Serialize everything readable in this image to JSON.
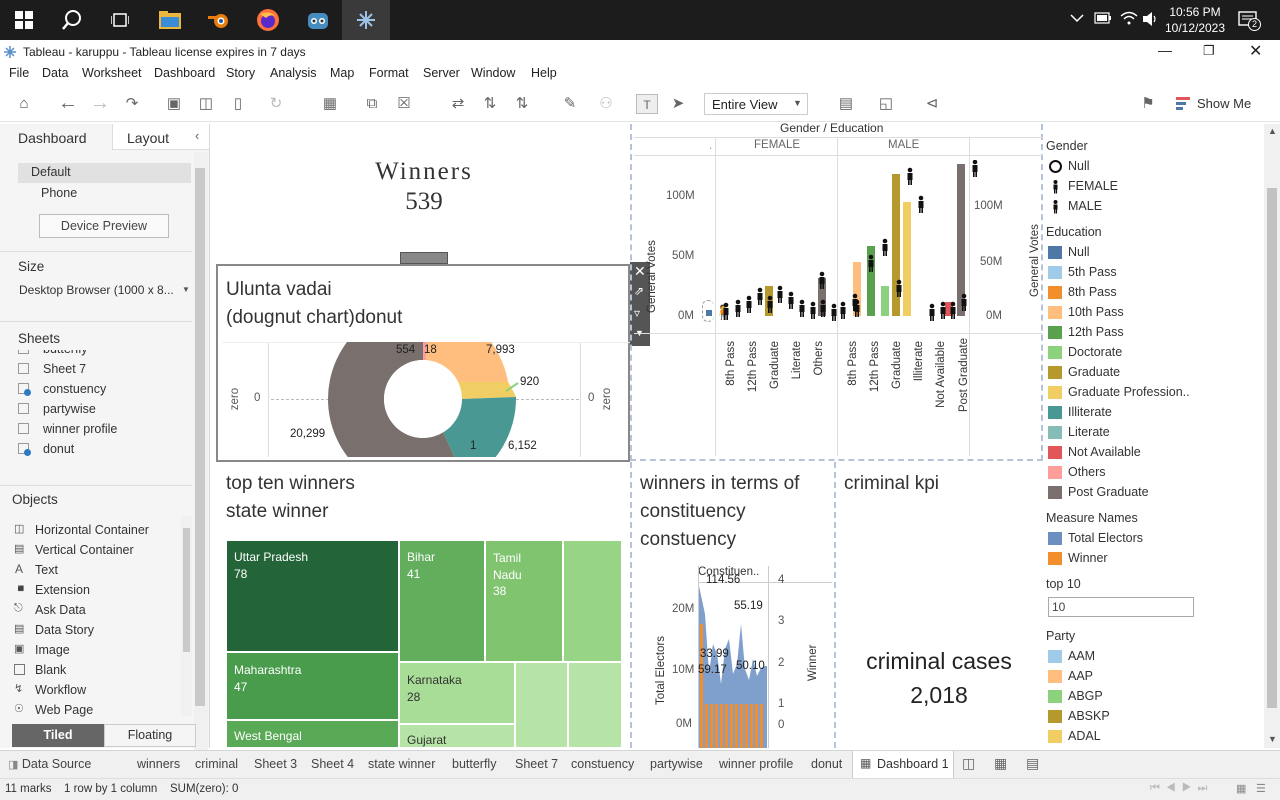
{
  "taskbar": {
    "time": "10:56 PM",
    "date": "10/12/2023",
    "notif": "2"
  },
  "window": {
    "title": "Tableau - karuppu - Tableau license expires in 7 days"
  },
  "menu": [
    "File",
    "Data",
    "Worksheet",
    "Dashboard",
    "Story",
    "Analysis",
    "Map",
    "Format",
    "Server",
    "Window",
    "Help"
  ],
  "toolbar": {
    "view": "Entire View",
    "show_me": "Show Me"
  },
  "left": {
    "tab_dashboard": "Dashboard",
    "tab_layout": "Layout",
    "device_default": "Default",
    "device_phone": "Phone",
    "device_preview": "Device Preview",
    "size_h": "Size",
    "size_value": "Desktop Browser (1000 x 8...",
    "sheets_h": "Sheets",
    "sheets": [
      "butterfly",
      "Sheet 7",
      "constuency",
      "partywise",
      "winner profile",
      "donut"
    ],
    "objects_h": "Objects",
    "objects": [
      "Horizontal Container",
      "Vertical Container",
      "Text",
      "Extension",
      "Ask Data",
      "Data Story",
      "Image",
      "Blank",
      "Workflow",
      "Web Page"
    ],
    "tiled": "Tiled",
    "floating": "Floating"
  },
  "winners": {
    "title": "Winners",
    "value": "539"
  },
  "donut": {
    "title1": "Ulunta vadai",
    "title2": "(dougnut chart)donut",
    "axis_left": "zero",
    "axis_right": "zero",
    "zero_l": "0",
    "zero_r": "0",
    "labels": [
      "554",
      "18",
      "7,993",
      "920",
      "20,299",
      "1",
      "6,152"
    ]
  },
  "gender_chart": {
    "header": "Gender / Education",
    "dot": ".",
    "female": "FEMALE",
    "male": "MALE",
    "yaxis": "General Votes",
    "yaxis_r": "General Votes",
    "ticks": [
      "100M",
      "50M",
      "0M"
    ],
    "female_cats": [
      "8th Pass",
      "12th Pass",
      "Graduate",
      "Literate",
      "Others"
    ],
    "male_cats": [
      "8th Pass",
      "12th Pass",
      "Graduate",
      "Illiterate",
      "Not Available",
      "Post Graduate"
    ]
  },
  "top_ten": {
    "title1": "top ten winners",
    "title2": "state winner",
    "cells": [
      {
        "name": "Uttar Pradesh",
        "v": "78"
      },
      {
        "name": "Bihar",
        "v": "41"
      },
      {
        "name": "Tamil Nadu",
        "v": "38"
      },
      {
        "name": "Maharashtra",
        "v": "47"
      },
      {
        "name": "Karnataka",
        "v": "28"
      },
      {
        "name": "West Bengal",
        "v": ""
      },
      {
        "name": "Gujarat",
        "v": ""
      }
    ]
  },
  "constituency": {
    "title1": "winners in terms of",
    "title2": "constituency",
    "title3": "constuency",
    "col": "Constituen..",
    "yaxis": "Total Electors",
    "yaxis_r": "Winner",
    "ticks": [
      "20M",
      "10M",
      "0M"
    ],
    "ticks_r": [
      "4",
      "3",
      "2",
      "1",
      "0"
    ],
    "labels": [
      "114.56",
      "55.19",
      "33.99",
      "59.17",
      "50.10"
    ]
  },
  "criminal": {
    "title": "criminal kpi",
    "label": "criminal cases",
    "value": "2,018"
  },
  "legend": {
    "gender_h": "Gender",
    "gender": [
      "Null",
      "FEMALE",
      "MALE"
    ],
    "education_h": "Education",
    "education": [
      {
        "label": "Null",
        "color": "#4e79a7"
      },
      {
        "label": "5th Pass",
        "color": "#a0cbe8"
      },
      {
        "label": "8th Pass",
        "color": "#f28e2b"
      },
      {
        "label": "10th Pass",
        "color": "#ffbe7d"
      },
      {
        "label": "12th Pass",
        "color": "#59a14f"
      },
      {
        "label": "Doctorate",
        "color": "#8cd17d"
      },
      {
        "label": "Graduate",
        "color": "#b6992d"
      },
      {
        "label": "Graduate Profession..",
        "color": "#f1ce63"
      },
      {
        "label": "Illiterate",
        "color": "#499894"
      },
      {
        "label": "Literate",
        "color": "#86bcb6"
      },
      {
        "label": "Not Available",
        "color": "#e15759"
      },
      {
        "label": "Others",
        "color": "#ff9d9a"
      },
      {
        "label": "Post Graduate",
        "color": "#79706e"
      }
    ],
    "measure_h": "Measure Names",
    "measures": [
      {
        "label": "Total Electors",
        "color": "#6b8fc0"
      },
      {
        "label": "Winner",
        "color": "#f28e2b"
      }
    ],
    "top10_h": "top 10",
    "top10_value": "10",
    "party_h": "Party",
    "party": [
      {
        "label": "AAM",
        "color": "#a0cbe8"
      },
      {
        "label": "AAP",
        "color": "#ffbe7d"
      },
      {
        "label": "ABGP",
        "color": "#8cd17d"
      },
      {
        "label": "ABSKP",
        "color": "#b6992d"
      },
      {
        "label": "ADAL",
        "color": "#f1ce63"
      }
    ]
  },
  "tabs": [
    "Data Source",
    "winners",
    "criminal",
    "Sheet 3",
    "Sheet 4",
    "state winner",
    "butterfly",
    "Sheet 7",
    "constuency",
    "partywise",
    "winner profile",
    "donut",
    "Dashboard 1"
  ],
  "status": {
    "marks": "11 marks",
    "rows": "1 row by 1 column",
    "sum": "SUM(zero): 0"
  }
}
